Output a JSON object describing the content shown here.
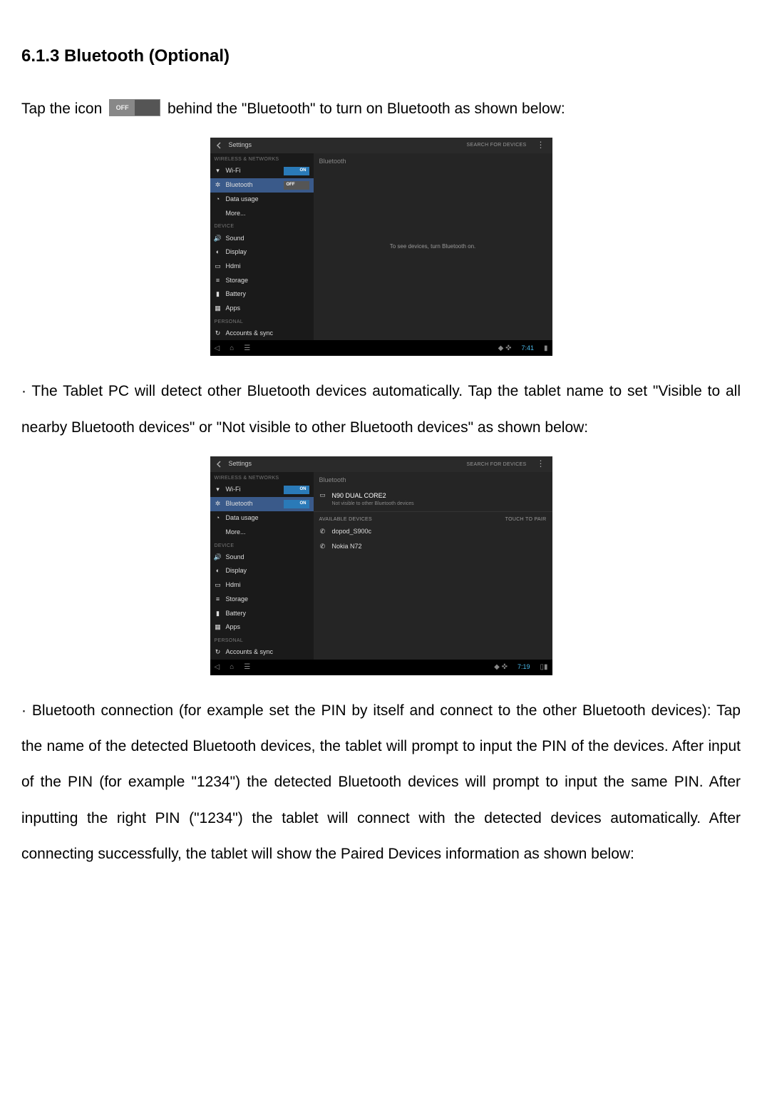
{
  "heading": "6.1.3 Bluetooth (Optional)",
  "para1a": "Tap the icon ",
  "para1b": " behind the \"Bluetooth\" to turn on Bluetooth as shown below:",
  "para2": "· The Tablet PC will detect other Bluetooth devices automatically. Tap the tablet name to set \"Visible to all nearby Bluetooth devices\" or \"Not visible to other Bluetooth devices\" as shown below:",
  "para3": "· Bluetooth connection (for example set the PIN by itself and connect to the other Bluetooth devices): Tap the name of the detected Bluetooth devices, the tablet will prompt to input the PIN of the devices. After input of the PIN (for example \"1234\") the detected Bluetooth devices will prompt to input the same PIN. After inputting the right PIN (\"1234\") the tablet will connect with the detected devices automatically. After connecting successfully, the tablet will show the Paired Devices information as shown below:",
  "ss": {
    "title": "Settings",
    "searchDevices": "SEARCH FOR DEVICES",
    "sections": {
      "wireless": "WIRELESS & NETWORKS",
      "device": "DEVICE",
      "personal": "PERSONAL"
    },
    "items": {
      "wifi": "Wi-Fi",
      "bluetooth": "Bluetooth",
      "dataUsage": "Data usage",
      "more": "More...",
      "sound": "Sound",
      "display": "Display",
      "hdmi": "Hdmi",
      "storage": "Storage",
      "battery": "Battery",
      "apps": "Apps",
      "accountsSync": "Accounts & sync"
    },
    "main1": {
      "title": "Bluetooth",
      "centerMsg": "To see devices, turn Bluetooth on."
    },
    "main2": {
      "title": "Bluetooth",
      "deviceName": "N90 DUAL CORE2",
      "deviceSub": "Not visible to other Bluetooth devices",
      "availLabel": "AVAILABLE DEVICES",
      "touchToPair": "TOUCH TO PAIR",
      "devices": [
        "dopod_S900c",
        "Nokia N72"
      ]
    },
    "nav": {
      "time1": "7:41",
      "time2": "7:19"
    }
  }
}
